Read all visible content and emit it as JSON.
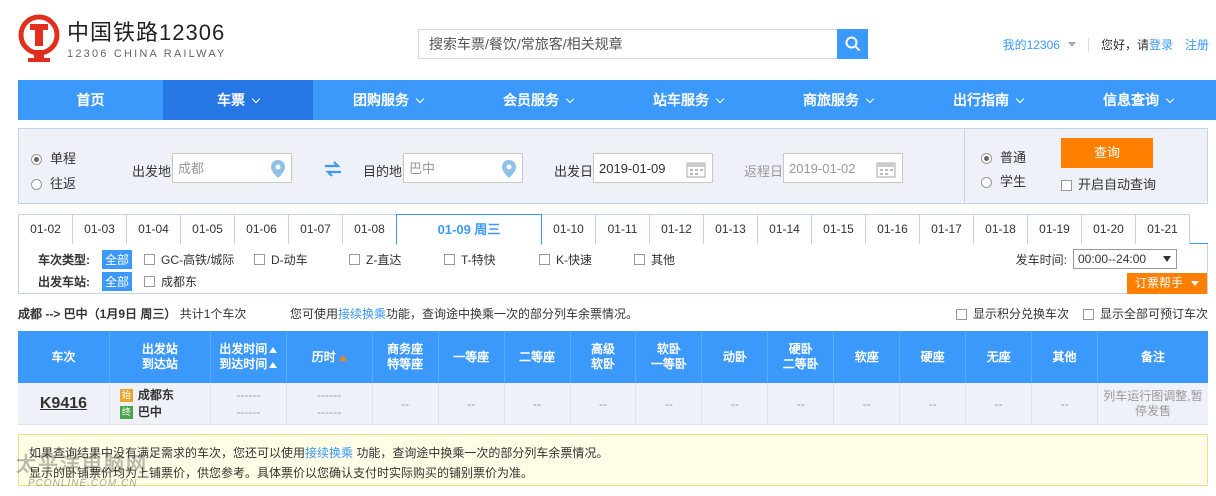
{
  "header": {
    "brand_cn": "中国铁路12306",
    "brand_en": "12306 CHINA RAILWAY",
    "search_placeholder": "搜索车票/餐饮/常旅客/相关规章",
    "my_account": "我的12306",
    "greeting": "您好，请",
    "login": "登录",
    "register": "注册"
  },
  "nav": {
    "items": [
      {
        "label": "首页"
      },
      {
        "label": "车票"
      },
      {
        "label": "团购服务"
      },
      {
        "label": "会员服务"
      },
      {
        "label": "站车服务"
      },
      {
        "label": "商旅服务"
      },
      {
        "label": "出行指南"
      },
      {
        "label": "信息查询"
      }
    ]
  },
  "query": {
    "one_way": "单程",
    "round_trip": "往返",
    "from_label": "出发地",
    "from_value": "成都",
    "to_label": "目的地",
    "to_value": "巴中",
    "date_label": "出发日",
    "date_value": "2019-01-09",
    "return_label": "返程日",
    "return_value": "2019-01-02",
    "normal": "普通",
    "student": "学生",
    "search_btn": "查询",
    "auto_query": "开启自动查询"
  },
  "dates": [
    "01-02",
    "01-03",
    "01-04",
    "01-05",
    "01-06",
    "01-07",
    "01-08",
    "01-09 周三",
    "01-10",
    "01-11",
    "01-12",
    "01-13",
    "01-14",
    "01-15",
    "01-16",
    "01-17",
    "01-18",
    "01-19",
    "01-20",
    "01-21"
  ],
  "filters": {
    "type_label": "车次类型:",
    "all": "全部",
    "types": [
      "GC-高铁/城际",
      "D-动车",
      "Z-直达",
      "T-特快",
      "K-快速",
      "其他"
    ],
    "station_label": "出发车站:",
    "stations": [
      "成都东"
    ],
    "dep_time_label": "发车时间:",
    "dep_time_value": "00:00--24:00",
    "helper": "订票帮手"
  },
  "summary": {
    "route": "成都 --> 巴中（1月9日  周三）",
    "count": "共计1个车次",
    "hint_pre": "您可使用",
    "hint_link": "接续换乘",
    "hint_post": "功能，查询途中换乘一次的部分列车余票情况。",
    "opt1": "显示积分兑换车次",
    "opt2": "显示全部可预订车次"
  },
  "table": {
    "headers": [
      {
        "l1": "车次",
        "l2": ""
      },
      {
        "l1": "出发站",
        "l2": "到达站"
      },
      {
        "l1": "出发时间",
        "l2": "到达时间"
      },
      {
        "l1": "历时",
        "l2": ""
      },
      {
        "l1": "商务座",
        "l2": "特等座"
      },
      {
        "l1": "一等座",
        "l2": ""
      },
      {
        "l1": "二等座",
        "l2": ""
      },
      {
        "l1": "高级",
        "l2": "软卧"
      },
      {
        "l1": "软卧",
        "l2": "一等卧"
      },
      {
        "l1": "动卧",
        "l2": ""
      },
      {
        "l1": "硬卧",
        "l2": "二等卧"
      },
      {
        "l1": "软座",
        "l2": ""
      },
      {
        "l1": "硬座",
        "l2": ""
      },
      {
        "l1": "无座",
        "l2": ""
      },
      {
        "l1": "其他",
        "l2": ""
      },
      {
        "l1": "备注",
        "l2": ""
      }
    ],
    "row": {
      "train": "K9416",
      "from_badge": "始",
      "from": "成都东",
      "to_badge": "终",
      "to": "巴中",
      "dep_time": "------",
      "arr_time": "------",
      "dur1": "------",
      "dur2": "------",
      "seat": "--",
      "remark": "列车运行图调整,暂停发售"
    }
  },
  "notice": {
    "line1_pre": "如果查询结果中没有满足需求的车次，您还可以使用",
    "line1_link": "接续换乘",
    "line1_post": " 功能，查询途中换乘一次的部分列车余票情况。",
    "line2": "显示的卧铺票价均为上铺票价，供您参考。具体票价以您确认支付时实际购买的铺别票价为准。"
  },
  "watermark": {
    "main": "太平洋电脑网",
    "sub": "PCONLINE.COM.CN"
  },
  "colors": {
    "primary": "#3b99fc",
    "accent": "#ff8000",
    "logo_red": "#e12e1d"
  }
}
